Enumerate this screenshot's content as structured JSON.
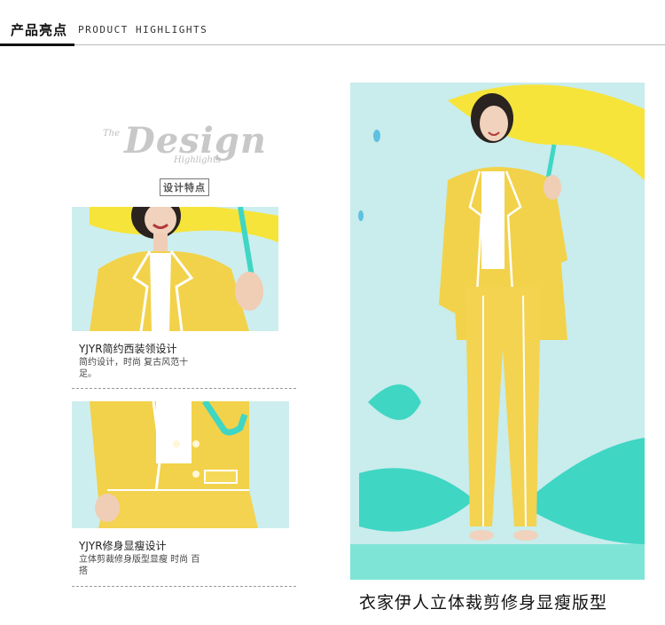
{
  "header": {
    "title": "产品亮点",
    "subtitle": "PRODUCT HIGHLIGHTS"
  },
  "logo": {
    "the": "The",
    "design": "Design",
    "highlights": "Highlights",
    "tag": "设计特点"
  },
  "features": [
    {
      "title": "YJYR简约西装领设计",
      "desc": "简约设计，时尚 复古风范十足。"
    },
    {
      "title": "YJYR修身显瘦设计",
      "desc": "立体剪裁修身版型显瘦 时尚 百搭"
    }
  ],
  "main_caption": "衣家伊人立体裁剪修身显瘦版型",
  "colors": {
    "suit_yellow": "#f2d24a",
    "umbrella_yellow": "#f6e43a",
    "teal": "#3fd6c4",
    "background_mint": "#c9ecec"
  }
}
